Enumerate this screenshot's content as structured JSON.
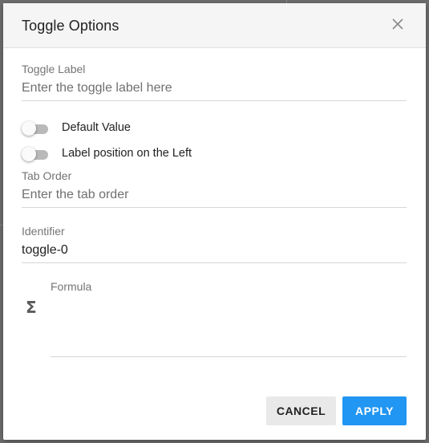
{
  "dialog": {
    "title": "Toggle Options",
    "close_icon": "close-icon"
  },
  "fields": {
    "toggle_label": {
      "label": "Toggle Label",
      "value": "",
      "placeholder": "Enter the toggle label here"
    },
    "tab_order": {
      "label": "Tab Order",
      "value": "",
      "placeholder": "Enter the tab order"
    },
    "identifier": {
      "label": "Identifier",
      "value": "toggle-0"
    },
    "formula": {
      "label": "Formula",
      "value": "",
      "icon": "sigma-icon"
    }
  },
  "toggles": {
    "default_value": {
      "label": "Default Value",
      "checked": false
    },
    "label_left": {
      "label": "Label position on the Left",
      "checked": false
    }
  },
  "buttons": {
    "cancel": "CANCEL",
    "apply": "APPLY"
  },
  "colors": {
    "accent": "#2196f3",
    "header_bg": "#f5f5f5",
    "backdrop": "#6e6e6e"
  }
}
